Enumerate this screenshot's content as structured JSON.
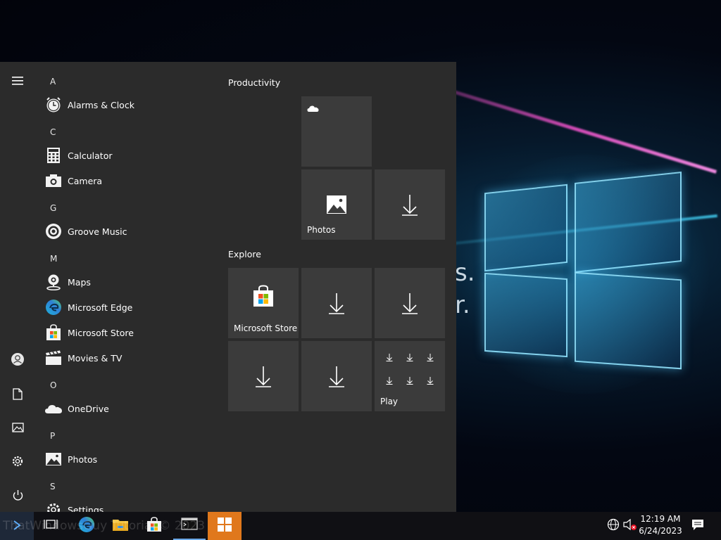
{
  "start_menu": {
    "sections": [
      {
        "letter": "A",
        "apps": [
          {
            "label": "Alarms & Clock",
            "icon": "alarm-clock-icon"
          }
        ]
      },
      {
        "letter": "C",
        "apps": [
          {
            "label": "Calculator",
            "icon": "calculator-icon"
          },
          {
            "label": "Camera",
            "icon": "camera-icon"
          }
        ]
      },
      {
        "letter": "G",
        "apps": [
          {
            "label": "Groove Music",
            "icon": "groove-music-icon"
          }
        ]
      },
      {
        "letter": "M",
        "apps": [
          {
            "label": "Maps",
            "icon": "maps-icon"
          },
          {
            "label": "Microsoft Edge",
            "icon": "edge-icon"
          },
          {
            "label": "Microsoft Store",
            "icon": "store-icon"
          },
          {
            "label": "Movies & TV",
            "icon": "movies-tv-icon"
          }
        ]
      },
      {
        "letter": "O",
        "apps": [
          {
            "label": "OneDrive",
            "icon": "onedrive-icon"
          }
        ]
      },
      {
        "letter": "P",
        "apps": [
          {
            "label": "Photos",
            "icon": "photos-icon"
          }
        ]
      },
      {
        "letter": "S",
        "apps": [
          {
            "label": "Settings",
            "icon": "settings-icon"
          }
        ]
      }
    ],
    "rail": [
      "hamburger-menu-icon",
      "user-account-icon",
      "documents-icon",
      "pictures-icon",
      "settings-gear-icon",
      "power-icon"
    ],
    "groups": [
      {
        "title": "Productivity",
        "tiles": [
          "",
          "Photos",
          ""
        ]
      },
      {
        "title": "Explore",
        "tiles": [
          "Microsoft Store",
          "",
          "",
          "",
          "",
          "Play"
        ]
      }
    ]
  },
  "taskbar": {
    "clock": {
      "time": "12:19 AM",
      "date": "6/24/2023"
    },
    "pinned": [
      "start-icon",
      "task-view-icon",
      "edge-icon",
      "file-explorer-icon",
      "store-icon",
      "terminal-icon",
      "windows-logo-icon"
    ],
    "watermark": "ThatWindowsGuy Tutorial © 2023"
  },
  "desktop": {
    "partial_text": [
      "s.",
      "r."
    ]
  },
  "colors": {
    "start_bg": "#2b2b2b",
    "tile_bg": "#3b3b3b",
    "taskbar_bg": "#101014",
    "active_accent": "#e0781c"
  }
}
